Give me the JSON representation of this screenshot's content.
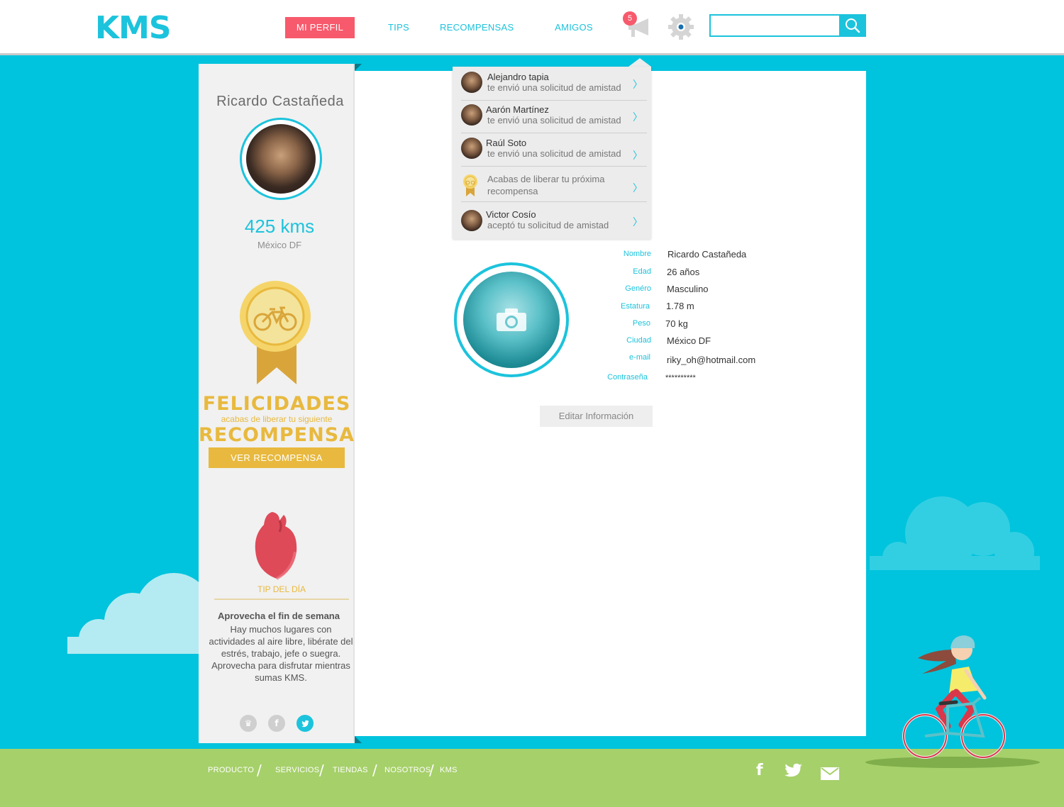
{
  "brand": {
    "logo_text": "KMS"
  },
  "nav": {
    "items": [
      {
        "label": "MI PERFIL",
        "active": true
      },
      {
        "label": "TIPS",
        "active": false
      },
      {
        "label": "RECOMPENSAS",
        "active": false
      },
      {
        "label": "AMIGOS",
        "active": false
      }
    ],
    "notification_count": "5",
    "search": {
      "value": "",
      "placeholder": ""
    }
  },
  "sidebar": {
    "user_name": "Ricardo Castañeda",
    "kms": "425 kms",
    "city": "México DF",
    "reward": {
      "title": "FELICIDADES",
      "subtitle": "acabas de liberar tu siguiente",
      "title2": "RECOMPENSA",
      "button_label": "VER RECOMPENSA"
    },
    "tip": {
      "label": "TIP DEL DÍA",
      "heading": "Aprovecha el fin de semana",
      "body": "Hay muchos lugares con actividades al aire libre, libérate del estrés, trabajo, jefe o suegra. Aprovecha para disfrutar mientras sumas KMS."
    },
    "social_icons": [
      "crown-icon",
      "facebook-icon",
      "twitter-icon"
    ]
  },
  "notifications": [
    {
      "name": "Alejandro tapia",
      "text": "te envió una solicitud de amistad",
      "icon": "avatar"
    },
    {
      "name": "Aarón Martínez",
      "text": "te envió una solicitud de amistad",
      "icon": "avatar"
    },
    {
      "name": "Raúl Soto",
      "text": "te envió una solicitud de amistad",
      "icon": "avatar"
    },
    {
      "name": "",
      "text": "Acabas de liberar tu próxima recompensa",
      "icon": "medal-icon"
    },
    {
      "name": "Victor Cosío",
      "text": "aceptó tu solicitud de amistad",
      "icon": "avatar"
    }
  ],
  "profile": {
    "fields": [
      {
        "label": "Nombre",
        "value": "Ricardo Castañeda"
      },
      {
        "label": "Edad",
        "value": "26 años"
      },
      {
        "label": "Genéro",
        "value": "Masculino"
      },
      {
        "label": "Estatura",
        "value": "1.78 m"
      },
      {
        "label": "Peso",
        "value": "70 kg"
      },
      {
        "label": "Ciudad",
        "value": "México DF"
      },
      {
        "label": "e-mail",
        "value": "riky_oh@hotmail.com"
      },
      {
        "label": "Contraseña",
        "value": "**********"
      }
    ],
    "edit_button": "Editar Información"
  },
  "footer": {
    "links": [
      "PRODUCTO",
      "SERVICIOS",
      "TIENDAS",
      "NOSOTROS",
      "KMS"
    ],
    "icons": [
      "facebook-icon",
      "twitter-icon",
      "mail-icon"
    ]
  },
  "colors": {
    "brand_cyan": "#1cc3dc",
    "sky": "#00c3dd",
    "accent_red": "#f75a6c",
    "gold": "#e8b93e",
    "grass": "#a6d06a"
  }
}
